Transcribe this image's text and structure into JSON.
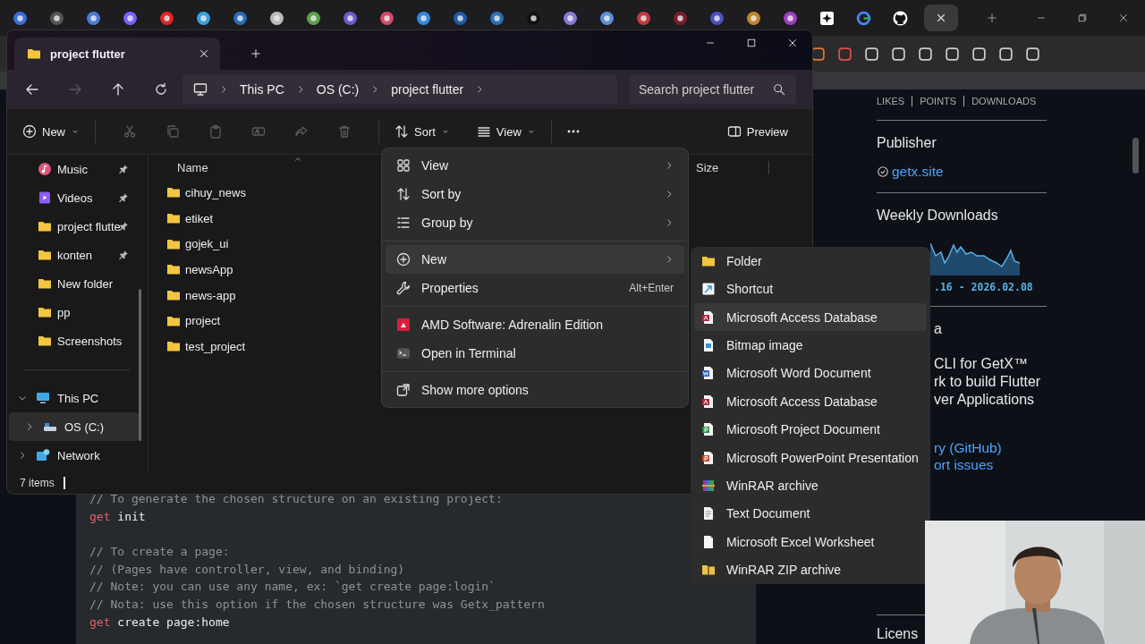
{
  "explorer": {
    "tab": {
      "title": "project flutter"
    },
    "nav": [
      {
        "kind": "back",
        "disabled": false
      },
      {
        "kind": "forward",
        "disabled": true
      },
      {
        "kind": "up",
        "disabled": false
      },
      {
        "kind": "refresh",
        "disabled": false
      }
    ],
    "breadcrumb": [
      "This PC",
      "OS (C:)",
      "project flutter"
    ],
    "search": {
      "placeholder": "Search project flutter"
    },
    "toolbar": {
      "new_label": "New",
      "actions": [
        {
          "kind": "cut",
          "disabled": true
        },
        {
          "kind": "copy",
          "disabled": true
        },
        {
          "kind": "paste",
          "disabled": true
        },
        {
          "kind": "rename",
          "disabled": true
        },
        {
          "kind": "share",
          "disabled": true
        },
        {
          "kind": "delete",
          "disabled": true
        }
      ],
      "sort_label": "Sort",
      "view_label": "View",
      "preview_label": "Preview"
    },
    "sidebar": {
      "quick_access": [
        {
          "label": "Music",
          "kind": "music",
          "pinned": true
        },
        {
          "label": "Videos",
          "kind": "video",
          "pinned": true
        },
        {
          "label": "project flutte",
          "kind": "folder",
          "pinned": true
        },
        {
          "label": "konten",
          "kind": "folder",
          "pinned": true
        },
        {
          "label": "New folder",
          "kind": "folder",
          "pinned": false
        },
        {
          "label": "pp",
          "kind": "folder",
          "pinned": false
        },
        {
          "label": "Screenshots",
          "kind": "folder",
          "pinned": false
        }
      ],
      "tree": [
        {
          "label": "This PC",
          "kind": "pc",
          "expanded": true,
          "selected": false,
          "children": [
            {
              "label": "OS (C:)",
              "kind": "drive",
              "expanded": false,
              "selected": true
            }
          ]
        },
        {
          "label": "Network",
          "kind": "network",
          "expanded": false,
          "selected": false
        }
      ]
    },
    "columns": [
      "Name",
      "Size"
    ],
    "files": [
      "cihuy_news",
      "etiket",
      "gojek_ui",
      "newsApp",
      "news-app",
      "project",
      "test_project"
    ],
    "status": "7 items"
  },
  "context_menu": {
    "items": [
      {
        "kind": "view",
        "label": "View",
        "submenu": true,
        "highlighted": false
      },
      {
        "kind": "sort",
        "label": "Sort by",
        "submenu": true,
        "highlighted": false
      },
      {
        "kind": "group",
        "label": "Group by",
        "submenu": true,
        "highlighted": false
      },
      {
        "kind": "separator"
      },
      {
        "kind": "new",
        "label": "New",
        "submenu": true,
        "highlighted": true
      },
      {
        "kind": "wrench",
        "label": "Properties",
        "shortcut": "Alt+Enter",
        "submenu": false,
        "highlighted": false
      },
      {
        "kind": "separator"
      },
      {
        "kind": "amd",
        "label": "AMD Software: Adrenalin Edition",
        "submenu": false,
        "highlighted": false
      },
      {
        "kind": "terminal",
        "label": "Open in Terminal",
        "submenu": false,
        "highlighted": false
      },
      {
        "kind": "separator"
      },
      {
        "kind": "more",
        "label": "Show more options",
        "submenu": false,
        "highlighted": false
      }
    ]
  },
  "new_submenu": {
    "items": [
      {
        "kind": "folder",
        "label": "Folder",
        "highlighted": false
      },
      {
        "kind": "shortcut",
        "label": "Shortcut",
        "highlighted": false
      },
      {
        "kind": "access",
        "label": "Microsoft Access Database",
        "highlighted": true
      },
      {
        "kind": "bitmap",
        "label": "Bitmap image",
        "highlighted": false
      },
      {
        "kind": "word",
        "label": "Microsoft Word Document",
        "highlighted": false
      },
      {
        "kind": "access",
        "label": "Microsoft Access Database",
        "highlighted": false
      },
      {
        "kind": "project",
        "label": "Microsoft Project Document",
        "highlighted": false
      },
      {
        "kind": "ppt",
        "label": "Microsoft PowerPoint Presentation",
        "highlighted": false
      },
      {
        "kind": "winrar",
        "label": "WinRAR archive",
        "highlighted": false
      },
      {
        "kind": "text",
        "label": "Text Document",
        "highlighted": false
      },
      {
        "kind": "excel",
        "label": "Microsoft Excel Worksheet",
        "highlighted": false
      },
      {
        "kind": "zip",
        "label": "WinRAR ZIP archive",
        "highlighted": false
      }
    ]
  },
  "page": {
    "stats_header": [
      "LIKES",
      "POINTS",
      "DOWNLOADS"
    ],
    "publisher_heading": "Publisher",
    "publisher_link": "getx.site",
    "downloads_heading": "Weekly Downloads",
    "downloads_range": ".16 - 2026.02.08",
    "metadata_heading": "a",
    "description_lines": [
      "CLI for GetX™",
      "rk to build Flutter",
      "ver Applications"
    ],
    "links": [
      "ry (GitHub)",
      "ort issues"
    ],
    "license_heading": "Licens",
    "code_lines": [
      {
        "kind": "comment",
        "text": "// To generate the chosen structure on an existing project:"
      },
      {
        "kind": "command",
        "keyword": "get",
        "text": "init"
      },
      {
        "kind": "blank"
      },
      {
        "kind": "comment",
        "text": "// To create a page:"
      },
      {
        "kind": "comment",
        "text": "// (Pages have controller, view, and binding)"
      },
      {
        "kind": "comment",
        "text": "// Note: you can use any name, ex: `get create page:login`"
      },
      {
        "kind": "comment",
        "text": "// Nota: use this option if the chosen structure was Getx_pattern"
      },
      {
        "kind": "command",
        "keyword": "get",
        "text": "create page:home"
      }
    ]
  }
}
